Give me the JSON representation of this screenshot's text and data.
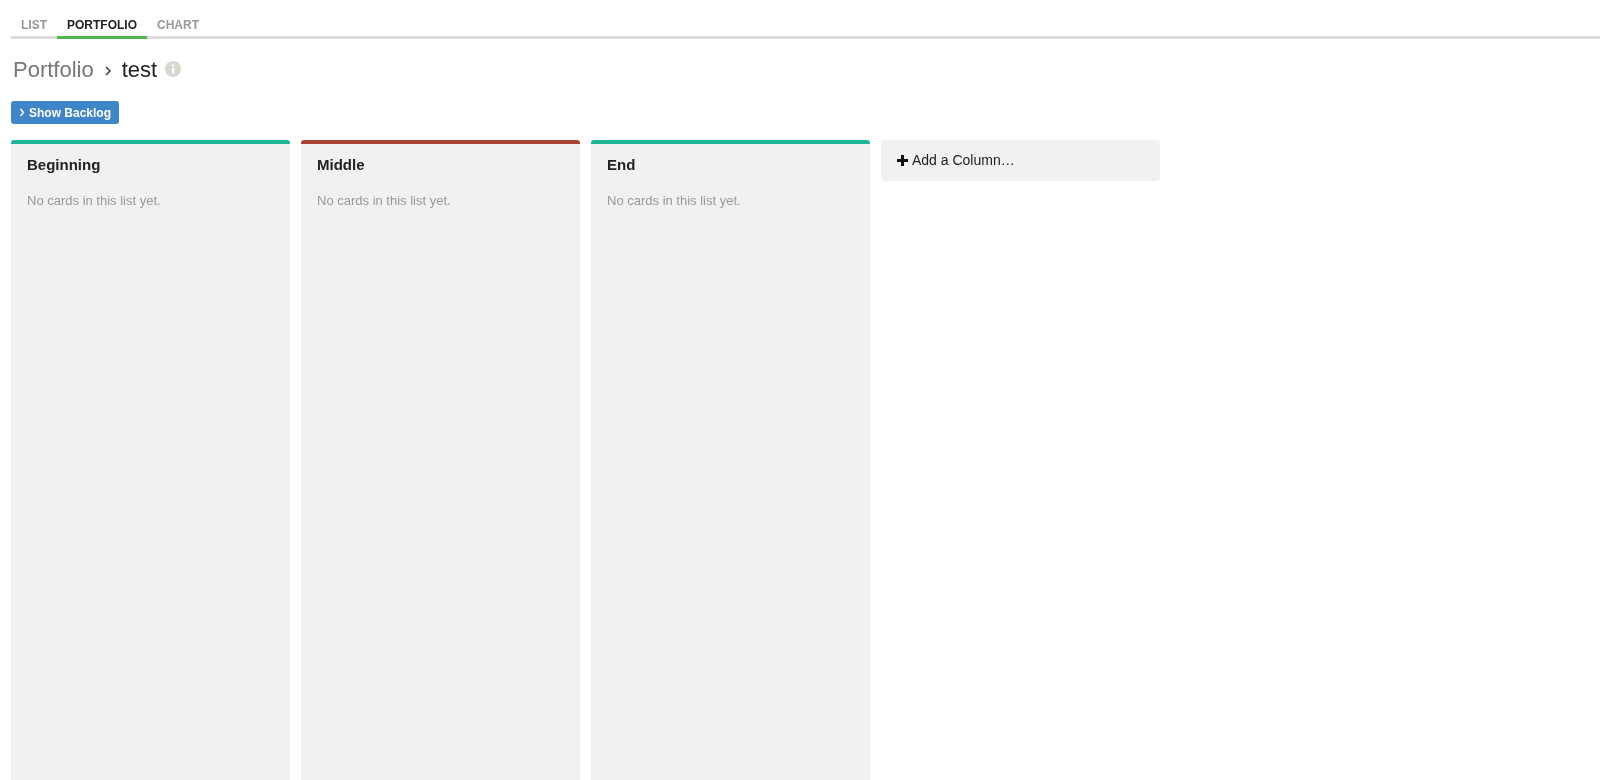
{
  "tabs": [
    {
      "label": "LIST",
      "selected": false
    },
    {
      "label": "PORTFOLIO",
      "selected": true
    },
    {
      "label": "CHART",
      "selected": false
    }
  ],
  "breadcrumb": {
    "parent": "Portfolio",
    "current": "test"
  },
  "backlog_button": {
    "label": "Show Backlog"
  },
  "columns": [
    {
      "title": "Beginning",
      "color": "#1fb596",
      "empty_text": "No cards in this list yet."
    },
    {
      "title": "Middle",
      "color": "#a84234",
      "empty_text": "No cards in this list yet."
    },
    {
      "title": "End",
      "color": "#1fb596",
      "empty_text": "No cards in this list yet."
    }
  ],
  "add_column": {
    "label": "Add a Column…"
  }
}
